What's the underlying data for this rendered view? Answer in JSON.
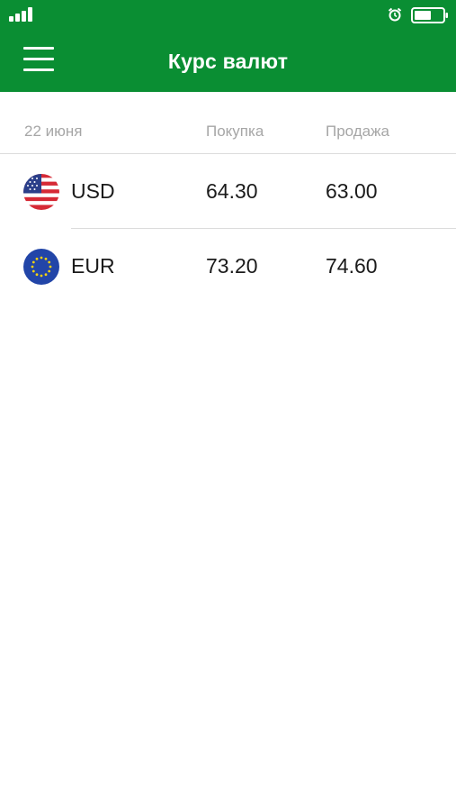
{
  "colors": {
    "appbar": "#0a8e33",
    "header_text": "#a6a6a6",
    "row_text": "#1b1b1b",
    "divider": "#dcdcdc"
  },
  "status_bar": {
    "icons": [
      "signal-icon",
      "alarm-icon",
      "battery-icon"
    ]
  },
  "header": {
    "menu_icon": "hamburger-menu-icon",
    "title": "Курс валют"
  },
  "table": {
    "columns": [
      "22 июня",
      "Покупка",
      "Продажа"
    ],
    "rows": [
      {
        "flag_icon": "us-flag-icon",
        "code": "USD",
        "buy": "64.30",
        "sell": "63.00"
      },
      {
        "flag_icon": "eu-flag-icon",
        "code": "EUR",
        "buy": "73.20",
        "sell": "74.60"
      }
    ]
  }
}
